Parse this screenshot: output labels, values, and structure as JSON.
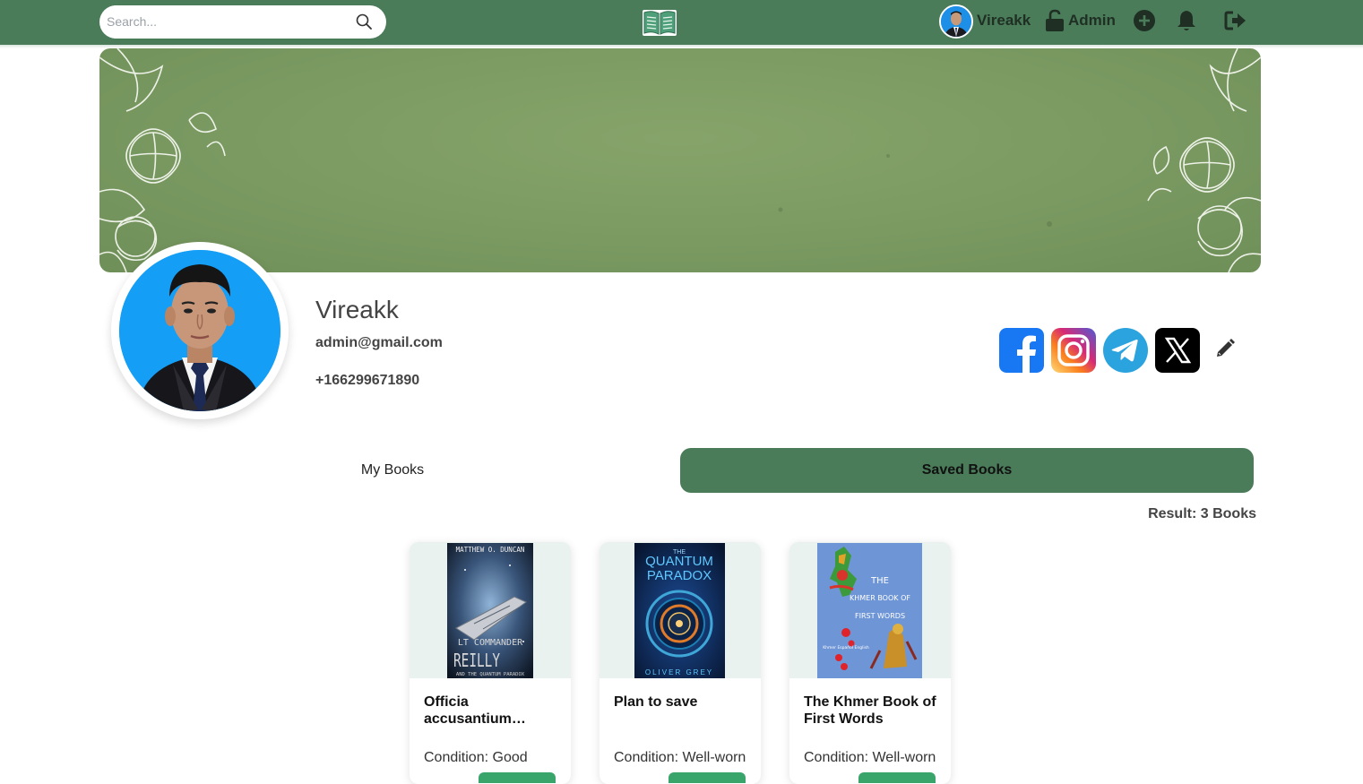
{
  "navbar": {
    "search_placeholder": "Search...",
    "username": "Vireakk",
    "role_label": "Admin",
    "icons": [
      "search-icon",
      "book-logo-icon",
      "lock-icon",
      "plus-circle-icon",
      "bell-icon",
      "logout-icon"
    ],
    "color": "#4a7c59"
  },
  "profile": {
    "name": "Vireakk",
    "email": "admin@gmail.com",
    "phone": "+166299671890",
    "social": [
      "facebook-icon",
      "instagram-icon",
      "telegram-icon",
      "x-icon"
    ],
    "edit_icon": "pencil-icon"
  },
  "tabs": {
    "my_books": "My Books",
    "saved_books": "Saved Books",
    "active": "saved_books"
  },
  "result_text": "Result: 3 Books",
  "books": [
    {
      "title": "Officia accusantium…",
      "condition": "Condition: Good",
      "cover": {
        "author": "MATTHEW O. DUNCAN",
        "line1": "LT COMMANDER",
        "line2": "REILLY",
        "line3": "AND THE QUANTUM PARADOX"
      }
    },
    {
      "title": "Plan to save",
      "condition": "Condition: Well-worn",
      "cover": {
        "small": "THE",
        "line1": "QUANTUM",
        "line2": "PARADOX",
        "author": "OLIVER GREY"
      }
    },
    {
      "title": "The Khmer Book of First Words",
      "condition": "Condition: Well-worn",
      "cover": {
        "line1": "THE",
        "line2": "KHMER BOOK OF",
        "line3": "FIRST WORDS",
        "langs": "Khmer Español English"
      }
    }
  ]
}
